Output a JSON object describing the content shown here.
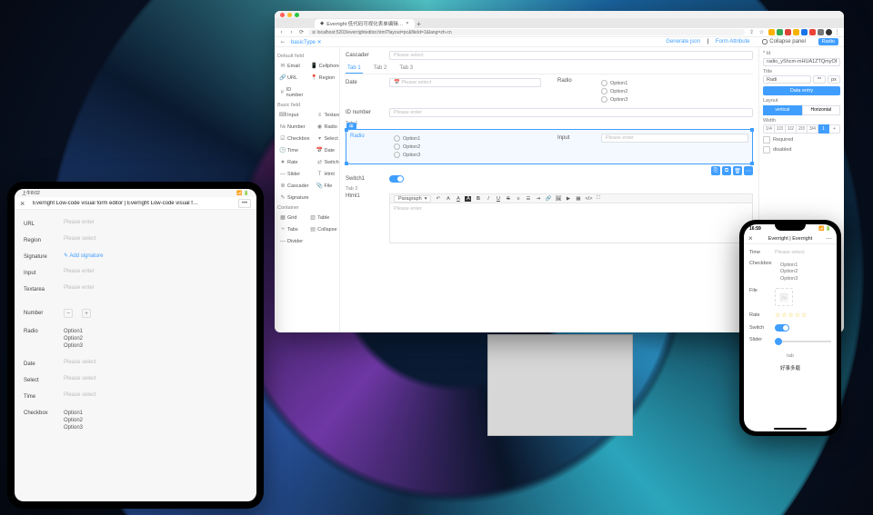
{
  "browser": {
    "tab_title": "Everright 低代码可视化表单编辑…",
    "url": "localhost:5203/everrighteditor.html?layout=pc&fileId=1&lang=zh-cn",
    "extension_colors": [
      "#ffb000",
      "#34a853",
      "#db4437",
      "#f4b400",
      "#1a73e8",
      "#ea4335",
      "#777",
      "#333",
      "#888",
      "#5f6368"
    ]
  },
  "appbar": {
    "breadcrumb_root": "←",
    "breadcrumb_item": "basicType ✕",
    "generate": "Generate json",
    "attr_tab": "Form Attribute",
    "collapse": "Collapse panel",
    "mode": "Radio"
  },
  "sidebar": {
    "sec1": "Default field",
    "sec2": "Basic field",
    "sec3": "Container",
    "default_fields": [
      {
        "icon": "✉",
        "label": "Email"
      },
      {
        "icon": "📱",
        "label": "Cellphone"
      },
      {
        "icon": "🔗",
        "label": "URL"
      },
      {
        "icon": "📍",
        "label": "Region"
      },
      {
        "icon": "#",
        "label": "ID number"
      }
    ],
    "basic_fields": [
      {
        "icon": "⌨",
        "label": "Input"
      },
      {
        "icon": "≡",
        "label": "Textarea"
      },
      {
        "icon": "№",
        "label": "Number"
      },
      {
        "icon": "◉",
        "label": "Radio"
      },
      {
        "icon": "☑",
        "label": "Checkbox"
      },
      {
        "icon": "▾",
        "label": "Select"
      },
      {
        "icon": "🕒",
        "label": "Time"
      },
      {
        "icon": "📅",
        "label": "Date"
      },
      {
        "icon": "★",
        "label": "Rate"
      },
      {
        "icon": "⇄",
        "label": "Switch"
      },
      {
        "icon": "—",
        "label": "Slider"
      },
      {
        "icon": "T",
        "label": "Html"
      },
      {
        "icon": "≣",
        "label": "Cascader"
      },
      {
        "icon": "📎",
        "label": "File"
      },
      {
        "icon": "✎",
        "label": "Signature"
      }
    ],
    "container_fields": [
      {
        "icon": "▦",
        "label": "Grid"
      },
      {
        "icon": "▥",
        "label": "Table"
      },
      {
        "icon": "⑂",
        "label": "Tabs"
      },
      {
        "icon": "▤",
        "label": "Collapse"
      },
      {
        "icon": "—",
        "label": "Divider"
      }
    ]
  },
  "canvas": {
    "cascader_label": "Cascader",
    "placeholder": "Please select",
    "tabs": [
      "Tab 1",
      "Tab 2",
      "Tab 3"
    ],
    "date_label": "Date",
    "date_ph": "Please select",
    "radio_label": "Radio",
    "radio_options": [
      "Option1",
      "Option2",
      "Option3"
    ],
    "idnumber_label": "ID number",
    "idnumber_ph": "Please enter",
    "subtab": "Tab 1",
    "sel_tag": "⊞",
    "sel_radio_label": "Radio",
    "sel_radio_options": [
      "Option1",
      "Option2",
      "Option3"
    ],
    "input_label": "Input",
    "input_ph": "Please enter",
    "toolbtn_icons": [
      "⎘",
      "⧉",
      "🗑",
      "⋯"
    ],
    "switch_label": "Switch1",
    "subtab2": "Tab 2",
    "html_label": "Html1",
    "rte_paragraph": "Paragraph",
    "rte_body_ph": "Please enter"
  },
  "props": {
    "id_label": "* Id",
    "id_value": "radio_yShcm-mHUA1ZTQmyOB",
    "title_label": "Title",
    "title_value": "Radi",
    "title_star": "**",
    "title_suffix": "px",
    "data_btn": "Data entry",
    "layout_label": "Layout",
    "layout_opts": [
      "vertical",
      "Horizontal"
    ],
    "width_label": "Width",
    "width_opts": [
      "1/4",
      "1/3",
      "1/2",
      "2/3",
      "3/4",
      "1",
      "+"
    ],
    "required": "Required",
    "disabled": "disabled"
  },
  "tablet": {
    "status_time": "上午8:02",
    "title": "Everright Low-code visual form editor | Everright Low-code visual f…",
    "menu": "•••",
    "rows": {
      "url": {
        "label": "URL",
        "ph": "Please enter"
      },
      "region": {
        "label": "Region",
        "ph": "Please select"
      },
      "signature": {
        "label": "Signature",
        "link": "Add signature"
      },
      "input": {
        "label": "Input",
        "ph": "Please enter"
      },
      "textarea": {
        "label": "Textarea",
        "ph": "Please enter"
      },
      "number": {
        "label": "Number"
      },
      "radio": {
        "label": "Radio",
        "opts": [
          "Option1",
          "Option2",
          "Option3"
        ]
      },
      "date": {
        "label": "Date",
        "ph": "Please select"
      },
      "select": {
        "label": "Select",
        "ph": "Please select"
      },
      "time": {
        "label": "Time",
        "ph": "Please select"
      },
      "checkbox": {
        "label": "Checkbox",
        "opts": [
          "Option1",
          "Option2",
          "Option3"
        ]
      }
    }
  },
  "phone": {
    "time": "16:59",
    "title": "Everright | Everright",
    "rows": {
      "time": {
        "label": "Time",
        "ph": "Please select"
      },
      "checkbox": {
        "label": "Checkbox",
        "opts": [
          "Option1",
          "Option2",
          "Option3"
        ]
      },
      "file": {
        "label": "File"
      },
      "rate": {
        "label": "Rate"
      },
      "switch": {
        "label": "Switch"
      },
      "slider": {
        "label": "Slider"
      },
      "tab": {
        "label": "tab"
      },
      "html": {
        "text": "好事多磨"
      }
    }
  }
}
